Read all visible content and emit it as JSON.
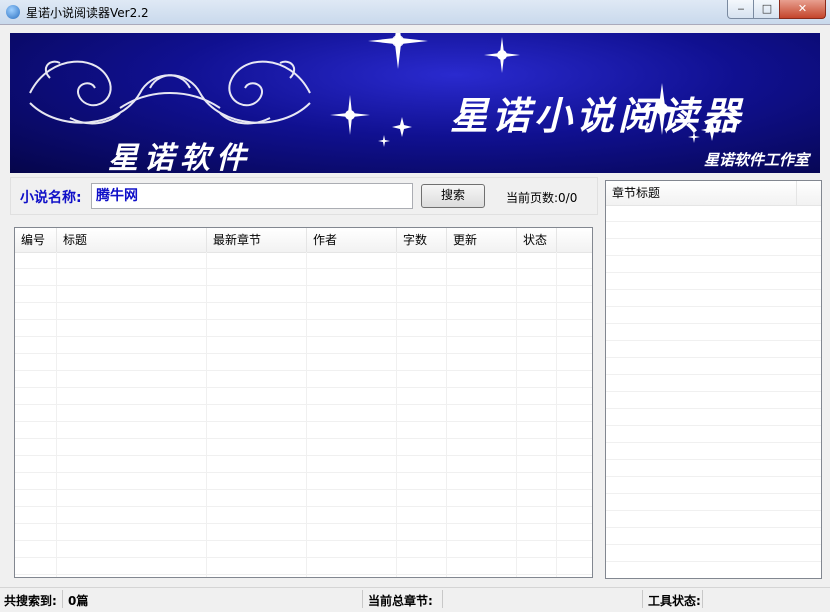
{
  "window": {
    "title": "星诺小说阅读器Ver2.2",
    "minimize_glyph": "‒",
    "maximize_glyph": "□",
    "close_glyph": "✕"
  },
  "banner": {
    "title": "星诺小说阅读器",
    "brand": "星诺软件",
    "studio": "星诺软件工作室"
  },
  "search": {
    "label": "小说名称:",
    "value": "腾牛网",
    "button": "搜索",
    "page_info": "当前页数:0/0"
  },
  "results_table": {
    "columns": [
      "编号",
      "标题",
      "最新章节",
      "作者",
      "字数",
      "更新",
      "状态"
    ],
    "rows": []
  },
  "chapters": {
    "header": "章节标题",
    "items": []
  },
  "status": {
    "found_label": "共搜索到:",
    "found_value": "0篇",
    "chapter_label": "当前总章节:",
    "chapter_value": "",
    "tool_label": "工具状态:",
    "tool_value": ""
  },
  "colors": {
    "label_blue": "#1010c8",
    "banner_blue": "#101090"
  }
}
